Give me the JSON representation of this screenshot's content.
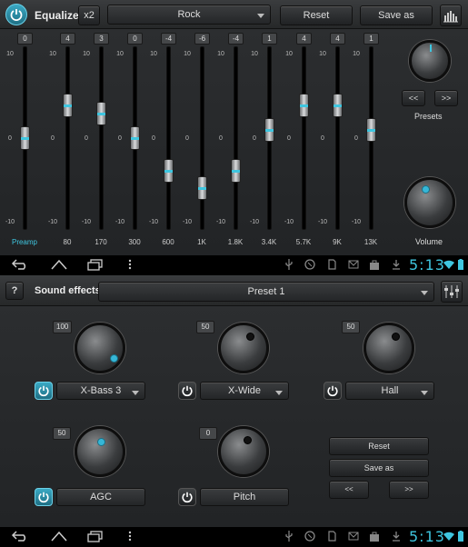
{
  "equalizer": {
    "title": "Equalizer",
    "x2_label": "x2",
    "preset_selected": "Rock",
    "reset_label": "Reset",
    "save_as_label": "Save as",
    "presets_label": "Presets",
    "prev_label": "<<",
    "next_label": ">>",
    "volume_label": "Volume",
    "scale_top": "10",
    "scale_mid": "0",
    "scale_bottom": "-10",
    "preamp": {
      "label": "Preamp",
      "value": "0",
      "level": 0
    },
    "bands": [
      {
        "label": "80",
        "value": "4",
        "level": 4
      },
      {
        "label": "170",
        "value": "3",
        "level": 3
      },
      {
        "label": "300",
        "value": "0",
        "level": 0
      },
      {
        "label": "600",
        "value": "-4",
        "level": -4
      },
      {
        "label": "1K",
        "value": "-6",
        "level": -6
      },
      {
        "label": "1.8K",
        "value": "-4",
        "level": -4
      },
      {
        "label": "3.4K",
        "value": "1",
        "level": 1
      },
      {
        "label": "5.7K",
        "value": "4",
        "level": 4
      },
      {
        "label": "9K",
        "value": "4",
        "level": 4
      },
      {
        "label": "13K",
        "value": "1",
        "level": 1
      }
    ]
  },
  "status": {
    "time": "5:13"
  },
  "sound_effects": {
    "help_label": "?",
    "title": "Sound effects",
    "preset_selected": "Preset 1",
    "reset_label": "Reset",
    "save_as_label": "Save as",
    "prev_label": "<<",
    "next_label": ">>",
    "effects": [
      {
        "value": "100",
        "name": "X-Bass 3",
        "enabled": true
      },
      {
        "value": "50",
        "name": "X-Wide",
        "enabled": false
      },
      {
        "value": "50",
        "name": "Hall",
        "enabled": false
      },
      {
        "value": "50",
        "name": "AGC",
        "enabled": true
      },
      {
        "value": "0",
        "name": "Pitch",
        "enabled": false
      }
    ]
  },
  "colors": {
    "accent": "#3fc6e0",
    "panel": "#2a2c2e",
    "nav_bg": "#000000"
  }
}
